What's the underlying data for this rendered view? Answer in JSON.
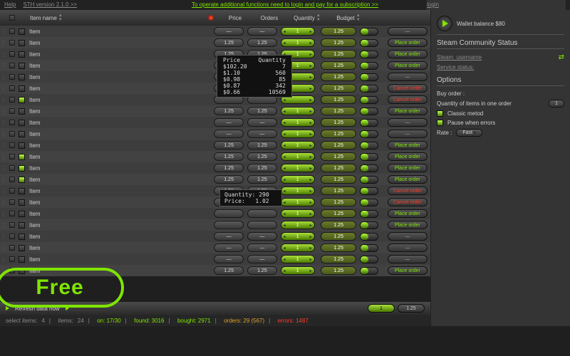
{
  "topbar": {
    "help": "Help",
    "version": "STH version 2.1.0 >>",
    "promo": "To operate additional functions need to login and pay for a subscription >>",
    "login": "login"
  },
  "columns": {
    "name": "Item name",
    "price": "Price",
    "orders": "Orders",
    "qty": "Quantity",
    "budget": "Budget"
  },
  "wallet": {
    "label": "Wallet balance",
    "amount": "$80"
  },
  "scs": {
    "title": "Steam Community Status",
    "user_lbl": "Steam_username",
    "service_lbl": "Service status:"
  },
  "options": {
    "title": "Options",
    "buy_order": "Buy order :",
    "qty_label": "Quantity of items in one order",
    "qty_val": "1",
    "classic": "Classic metod",
    "pause": "Pause when errors",
    "rate_lbl": "Rate :",
    "rate_val": "Fast"
  },
  "actions": {
    "place": "Place order",
    "cancel": "Cancel order",
    "dash": "—",
    "refresh": "Refresh data now"
  },
  "tip1": {
    "h_price": "Price",
    "h_qty": "Quantity",
    "rows": [
      {
        "p": "$102.20",
        "q": "7"
      },
      {
        "p": "$1.10",
        "q": "560"
      },
      {
        "p": "$0.98",
        "q": "85"
      },
      {
        "p": "$0.87",
        "q": "342"
      },
      {
        "p": "$0.66",
        "q": "10569"
      }
    ]
  },
  "tip2": {
    "qty_lbl": "Quantity:",
    "qty": "290",
    "price_lbl": "Price:",
    "price": "1.02"
  },
  "free": "Free",
  "pager": {
    "cur": "1",
    "total": "1.25"
  },
  "status": {
    "sel_lbl": "select items:",
    "sel": "4",
    "items_lbl": "items:",
    "items": "24",
    "on_lbl": "on:",
    "on": "17/30",
    "found_lbl": "found:",
    "found": "3016",
    "bought_lbl": "bought:",
    "bought": "2971",
    "orders_lbl": "orders:",
    "orders": "29 (567)",
    "err_lbl": "errors:",
    "err": "1487"
  },
  "rows": [
    {
      "name": "Item",
      "price": "—",
      "orders": "—",
      "qty": "1",
      "budget": "1.25",
      "on": true,
      "chk": false,
      "act": "dash"
    },
    {
      "name": "Item",
      "price": "1.25",
      "orders": "1.25",
      "qty": "1",
      "budget": "1.25",
      "on": true,
      "chk": false,
      "act": "place"
    },
    {
      "name": "Item",
      "price": "1.25",
      "orders": "1.25",
      "qty": "1",
      "budget": "1.25",
      "on": true,
      "chk": false,
      "act": "place"
    },
    {
      "name": "Item",
      "price": "1.25",
      "orders": "1.25",
      "qty": "1",
      "budget": "1.25",
      "on": true,
      "chk": false,
      "act": "place"
    },
    {
      "name": "Item",
      "price": "",
      "orders": "",
      "qty": "",
      "budget": "1.25",
      "on": true,
      "chk": false,
      "act": "dash"
    },
    {
      "name": "Item",
      "price": "",
      "orders": "",
      "qty": "",
      "budget": "1.25",
      "on": true,
      "chk": false,
      "act": "cancel"
    },
    {
      "name": "Item",
      "price": "",
      "orders": "",
      "qty": "",
      "budget": "1.25",
      "on": true,
      "chk": true,
      "act": "cancel"
    },
    {
      "name": "Item",
      "price": "1.25",
      "orders": "1.25",
      "qty": "1",
      "budget": "1.25",
      "on": true,
      "chk": false,
      "act": "place"
    },
    {
      "name": "Item",
      "price": "—",
      "orders": "—",
      "qty": "1",
      "budget": "1.25",
      "on": true,
      "chk": false,
      "act": "dash"
    },
    {
      "name": "Item",
      "price": "—",
      "orders": "—",
      "qty": "1",
      "budget": "1.25",
      "on": true,
      "chk": false,
      "act": "dash"
    },
    {
      "name": "Item",
      "price": "1.25",
      "orders": "1.25",
      "qty": "1",
      "budget": "1.25",
      "on": true,
      "chk": false,
      "act": "place"
    },
    {
      "name": "Item",
      "price": "1.25",
      "orders": "1.25",
      "qty": "1",
      "budget": "1.25",
      "on": true,
      "chk": true,
      "act": "place"
    },
    {
      "name": "Item",
      "price": "1.25",
      "orders": "1.25",
      "qty": "1",
      "budget": "1.25",
      "on": true,
      "chk": true,
      "act": "place"
    },
    {
      "name": "Item",
      "price": "1.25",
      "orders": "1.25",
      "qty": "1",
      "budget": "1.25",
      "on": true,
      "chk": true,
      "act": "place"
    },
    {
      "name": "Item",
      "price": "1.25",
      "orders": "1.25",
      "qty": "1",
      "budget": "1.25",
      "on": true,
      "chk": false,
      "act": "cancel"
    },
    {
      "name": "Item",
      "price": "—",
      "orders": "—",
      "qty": "1",
      "budget": "1.25",
      "on": true,
      "chk": false,
      "act": "cancel"
    },
    {
      "name": "Item",
      "price": "",
      "orders": "",
      "qty": "1",
      "budget": "1.25",
      "on": true,
      "chk": false,
      "act": "place"
    },
    {
      "name": "Item",
      "price": "",
      "orders": "",
      "qty": "1",
      "budget": "1.25",
      "on": true,
      "chk": false,
      "act": "place"
    },
    {
      "name": "Item",
      "price": "—",
      "orders": "—",
      "qty": "1",
      "budget": "1.25",
      "on": true,
      "chk": false,
      "act": "dash"
    },
    {
      "name": "Item",
      "price": "—",
      "orders": "—",
      "qty": "1",
      "budget": "1.25",
      "on": true,
      "chk": false,
      "act": "dash"
    },
    {
      "name": "Item",
      "price": "—",
      "orders": "—",
      "qty": "1",
      "budget": "1.25",
      "on": true,
      "chk": false,
      "act": "dash"
    },
    {
      "name": "Item",
      "price": "1.25",
      "orders": "1.25",
      "qty": "1",
      "budget": "1.25",
      "on": true,
      "chk": false,
      "act": "place"
    }
  ]
}
